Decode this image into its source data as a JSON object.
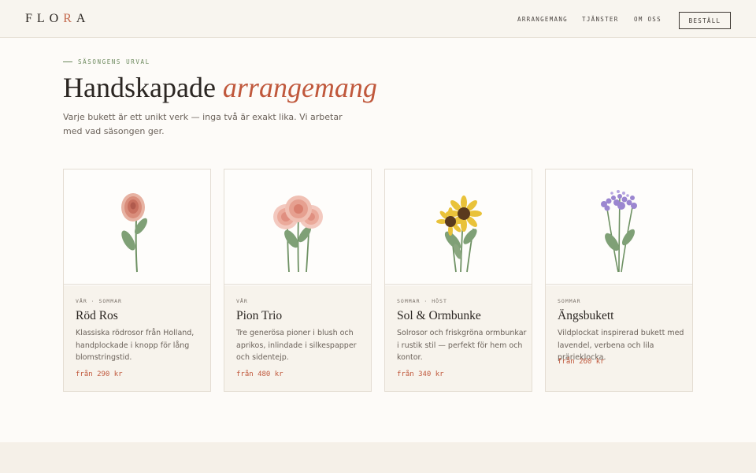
{
  "header": {
    "logo": [
      "FLO",
      "R",
      "A"
    ],
    "nav": [
      "ARRANGEMANG",
      "TJÄNSTER",
      "OM OSS"
    ],
    "order_label": "BESTÄLL"
  },
  "hero": {
    "eyebrow": "SÄSONGENS URVAL",
    "title_plain": "Handskapade",
    "title_italic": "arrangemang",
    "intro": "Varje bukett är ett unikt verk — inga två är exakt lika. Vi arbetar med vad säsongen ger."
  },
  "products": [
    {
      "season": "VÅR · SOMMAR",
      "name": "Röd Ros",
      "description": "Klassiska rödrosor från Holland, handplockade i knopp för lång blomstringstid.",
      "price": "från 290 kr",
      "icon": "red-rose-icon"
    },
    {
      "season": "VÅR",
      "name": "Pion Trio",
      "description": "Tre generösa pioner i blush och aprikos, inlindade i silkespapper och sidentejp.",
      "price": "från 480 kr",
      "icon": "peony-trio-icon"
    },
    {
      "season": "SOMMAR · HÖST",
      "name": "Sol & Ormbunke",
      "description": "Solrosor och friskgröna ormbunkar i rustik stil — perfekt för hem och kontor.",
      "price": "från 340 kr",
      "icon": "sunflower-icon"
    },
    {
      "season": "SOMMAR",
      "name": "Ängsbukett",
      "description": "Vildplockat inspirerad bukett med lavendel, verbena och lila prärieklocka.",
      "price": "från 260 kr",
      "icon": "meadow-bouquet-icon"
    }
  ],
  "colors": {
    "accent": "#c0583c",
    "green": "#6d8a5e",
    "background": "#fdfbf8"
  }
}
